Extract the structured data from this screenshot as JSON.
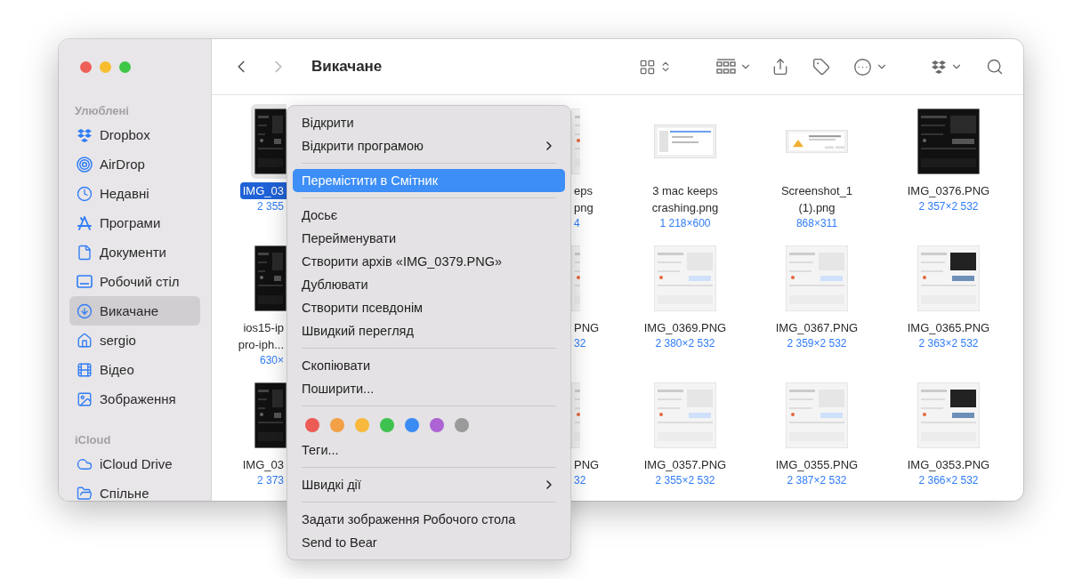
{
  "window": {
    "title": "Викачане"
  },
  "nav": [
    {
      "kind": "back",
      "disabled": false
    },
    {
      "kind": "forward",
      "disabled": true
    }
  ],
  "sidebar": {
    "sections": [
      {
        "title": "Улюблені",
        "items": [
          {
            "label": "Dropbox",
            "selected": false
          },
          {
            "label": "AirDrop",
            "selected": false
          },
          {
            "label": "Недавні",
            "selected": false
          },
          {
            "label": "Програми",
            "selected": false
          },
          {
            "label": "Документи",
            "selected": false
          },
          {
            "label": "Робочий стіл",
            "selected": false
          },
          {
            "label": "Викачане",
            "selected": true
          },
          {
            "label": "sergio",
            "selected": false
          },
          {
            "label": "Відео",
            "selected": false
          },
          {
            "label": "Зображення",
            "selected": false
          }
        ]
      },
      {
        "title": "iCloud",
        "items": [
          {
            "label": "iCloud Drive",
            "selected": false
          },
          {
            "label": "Спільне",
            "selected": false
          }
        ]
      }
    ]
  },
  "files": {
    "rows": [
      [
        {
          "kind": "cut-right",
          "name": [
            "IMG_03"
          ],
          "size": "2 355",
          "selected": true
        },
        {
          "kind": "cut-left",
          "name": [
            "eps",
            "png"
          ],
          "size": "4",
          "selected": false
        },
        {
          "kind": "full",
          "name": [
            "3 mac keeps",
            "crashing.png"
          ],
          "size": "1 218×600",
          "selected": false
        },
        {
          "kind": "full",
          "name": [
            "Screenshot_1",
            "(1).png"
          ],
          "size": "868×311",
          "selected": false
        },
        {
          "kind": "full",
          "name": [
            "IMG_0376.PNG"
          ],
          "size": "2 357×2 532",
          "selected": false
        }
      ],
      [
        {
          "kind": "cut-right",
          "name": [
            "ios15-ip",
            "pro-iph..."
          ],
          "size": "630×",
          "selected": false
        },
        {
          "kind": "cut-left",
          "name": [
            "PNG"
          ],
          "size": "32",
          "selected": false
        },
        {
          "kind": "full",
          "name": [
            "IMG_0369.PNG"
          ],
          "size": "2 380×2 532",
          "selected": false
        },
        {
          "kind": "full",
          "name": [
            "IMG_0367.PNG"
          ],
          "size": "2 359×2 532",
          "selected": false
        },
        {
          "kind": "full",
          "name": [
            "IMG_0365.PNG"
          ],
          "size": "2 363×2 532",
          "selected": false
        }
      ],
      [
        {
          "kind": "cut-right",
          "name": [
            "IMG_03"
          ],
          "size": "2 373",
          "selected": false
        },
        {
          "kind": "cut-left",
          "name": [
            "PNG"
          ],
          "size": "32",
          "selected": false
        },
        {
          "kind": "full",
          "name": [
            "IMG_0357.PNG"
          ],
          "size": "2 355×2 532",
          "selected": false
        },
        {
          "kind": "full",
          "name": [
            "IMG_0355.PNG"
          ],
          "size": "2 387×2 532",
          "selected": false
        },
        {
          "kind": "full",
          "name": [
            "IMG_0353.PNG"
          ],
          "size": "2 366×2 532",
          "selected": false
        }
      ]
    ]
  },
  "context_menu": {
    "entries": [
      {
        "kind": "item",
        "label": "Відкрити",
        "submenu": false,
        "selected": false
      },
      {
        "kind": "item",
        "label": "Відкрити програмою",
        "submenu": true,
        "selected": false
      },
      {
        "kind": "separator"
      },
      {
        "kind": "item",
        "label": "Перемістити в Смітник",
        "submenu": false,
        "selected": true
      },
      {
        "kind": "separator"
      },
      {
        "kind": "item",
        "label": "Досьє",
        "submenu": false,
        "selected": false
      },
      {
        "kind": "item",
        "label": "Перейменувати",
        "submenu": false,
        "selected": false
      },
      {
        "kind": "item",
        "label": "Створити архів «IMG_0379.PNG»",
        "submenu": false,
        "selected": false
      },
      {
        "kind": "item",
        "label": "Дублювати",
        "submenu": false,
        "selected": false
      },
      {
        "kind": "item",
        "label": "Створити псевдонім",
        "submenu": false,
        "selected": false
      },
      {
        "kind": "item",
        "label": "Швидкий перегляд",
        "submenu": false,
        "selected": false
      },
      {
        "kind": "separator"
      },
      {
        "kind": "item",
        "label": "Скопіювати",
        "submenu": false,
        "selected": false
      },
      {
        "kind": "item",
        "label": "Поширити...",
        "submenu": false,
        "selected": false
      },
      {
        "kind": "separator"
      },
      {
        "kind": "tags",
        "colors": [
          {
            "color": "#ec5b56"
          },
          {
            "color": "#f3a046"
          },
          {
            "color": "#f7b83d"
          },
          {
            "color": "#3fc14f"
          },
          {
            "color": "#3b8bf5"
          },
          {
            "color": "#ad63d3"
          },
          {
            "color": "#9a9a9a"
          }
        ]
      },
      {
        "kind": "item",
        "label": "Теги...",
        "submenu": false,
        "selected": false
      },
      {
        "kind": "separator"
      },
      {
        "kind": "item",
        "label": "Швидкі дії",
        "submenu": true,
        "selected": false
      },
      {
        "kind": "separator"
      },
      {
        "kind": "item",
        "label": "Задати зображення Робочого стола",
        "submenu": false,
        "selected": false
      },
      {
        "kind": "item",
        "label": "Send to Bear",
        "submenu": false,
        "selected": false
      }
    ]
  }
}
